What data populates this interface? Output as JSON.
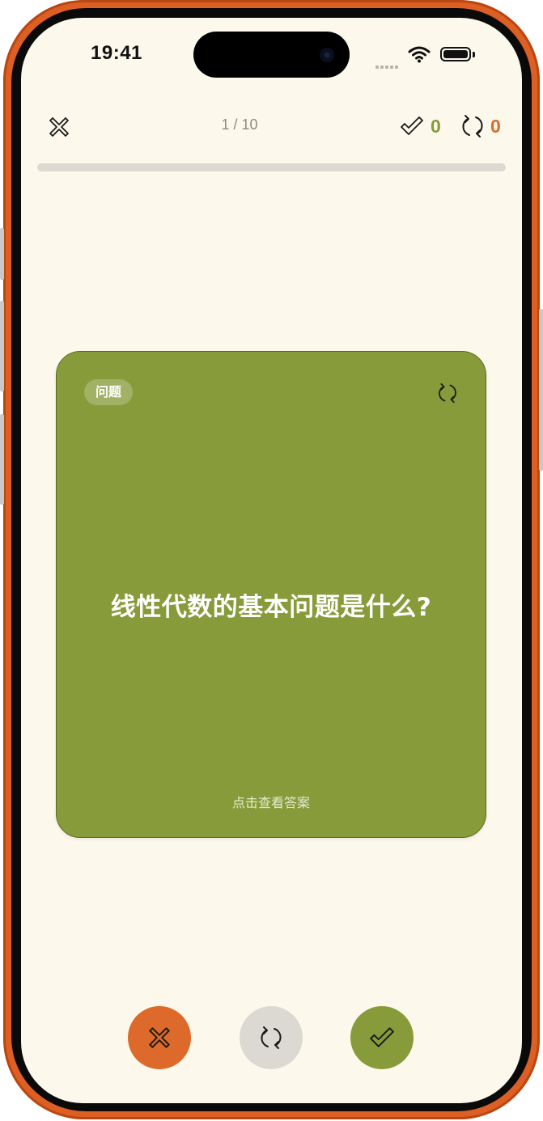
{
  "status_bar": {
    "time": "19:41"
  },
  "header": {
    "progress_text": "1 / 10",
    "known_count": "0",
    "review_count": "0"
  },
  "progress": {
    "fraction": 0.0
  },
  "card": {
    "badge": "问题",
    "question": "线性代数的基本问题是什么?",
    "hint": "点击查看答案"
  },
  "colors": {
    "accent_green": "#889b3a",
    "accent_orange": "#dd6a2a",
    "background": "#fcf9ec"
  },
  "icons": {
    "close": "close-x-icon",
    "known": "check-icon",
    "review": "refresh-icon"
  }
}
